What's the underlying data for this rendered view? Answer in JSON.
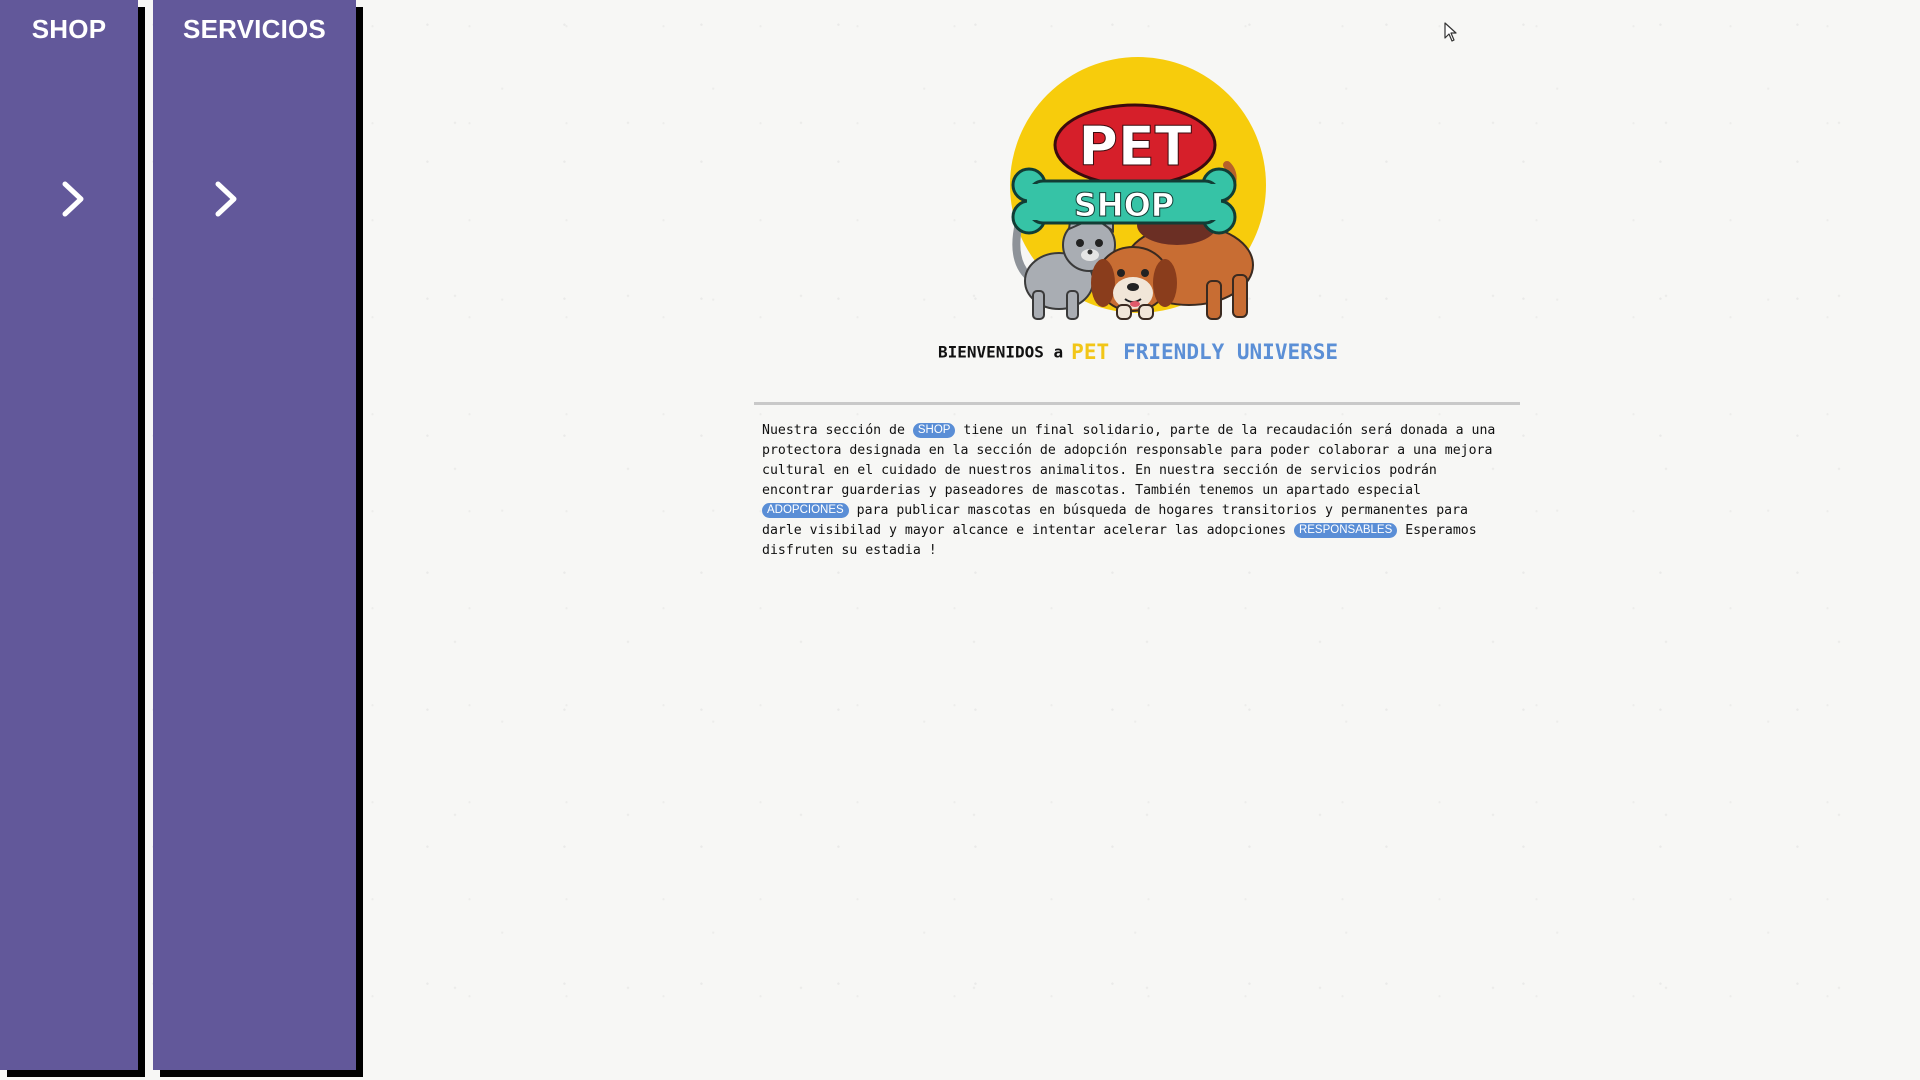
{
  "sidebar": {
    "shop": {
      "title": "SHOP"
    },
    "servicios": {
      "title": "SERVICIOS"
    }
  },
  "logo": {
    "line1": "PET",
    "line2": "SHOP"
  },
  "welcome": {
    "main": "BIENVENIDOS a",
    "pet": "PET",
    "rest": "FRIENDLY UNIVERSE"
  },
  "intro": {
    "p1": "Nuestra sección de ",
    "tag_shop": "SHOP",
    "p2": " tiene un final solidario, parte de la recaudación será donada a una protectora designada en la sección de adopción responsable para poder colaborar a una mejora cultural en el cuidado de nuestros animalitos. En nuestra sección de servicios podrán encontrar guarderias y paseadores de mascotas. También tenemos un apartado especial ",
    "tag_adopciones": "ADOPCIONES",
    "p3": " para publicar mascotas en búsqueda de hogares transitorios y permanentes para darle visibilad y mayor alcance e intentar acelerar las adopciones ",
    "tag_responsables": "RESPONSABLES",
    "p4": " Esperamos disfruten su estadia !"
  },
  "colors": {
    "panel": "#62589a",
    "tag": "#5a8ed6",
    "pet_yellow": "#f2c618",
    "universe_blue": "#5b8fd6"
  },
  "icons": [
    "chevron-right-icon",
    "mouse-cursor-icon"
  ]
}
